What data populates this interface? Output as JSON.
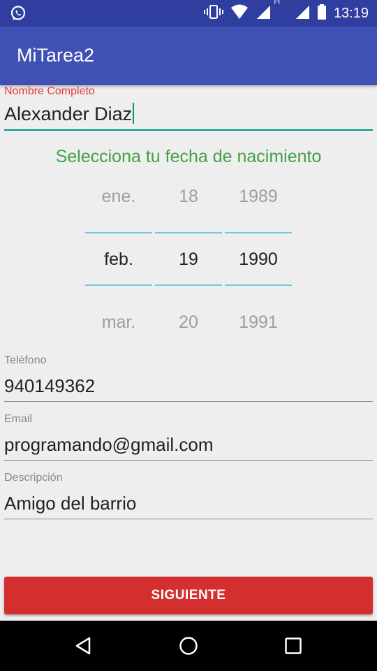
{
  "status_bar": {
    "time": "13:19",
    "icons": [
      "whatsapp-icon",
      "vibrate-icon",
      "wifi-icon",
      "signal-icon",
      "hspa-icon",
      "signal-icon",
      "battery-icon"
    ],
    "network_label": "H"
  },
  "app_bar": {
    "title": "MiTarea2"
  },
  "form": {
    "name": {
      "label": "Nombre Completo",
      "value": "Alexander Diaz"
    },
    "date_title": "Selecciona tu fecha de nacimiento",
    "date_picker": {
      "month": {
        "prev": "ene.",
        "current": "feb.",
        "next": "mar."
      },
      "day": {
        "prev": "18",
        "current": "19",
        "next": "20"
      },
      "year": {
        "prev": "1989",
        "current": "1990",
        "next": "1991"
      }
    },
    "phone": {
      "label": "Teléfono",
      "value": "940149362"
    },
    "email": {
      "label": "Email",
      "value": "programando@gmail.com"
    },
    "description": {
      "label": "Descripción",
      "value": "Amigo del barrio"
    },
    "next_button": "SIGUIENTE"
  },
  "nav_bar": {
    "icons": [
      "back-icon",
      "home-icon",
      "recents-icon"
    ]
  },
  "colors": {
    "status_bar": "#303f9f",
    "app_bar": "#3f51b5",
    "accent": "#009688",
    "button": "#d32f2f",
    "date_title": "#43a047"
  }
}
